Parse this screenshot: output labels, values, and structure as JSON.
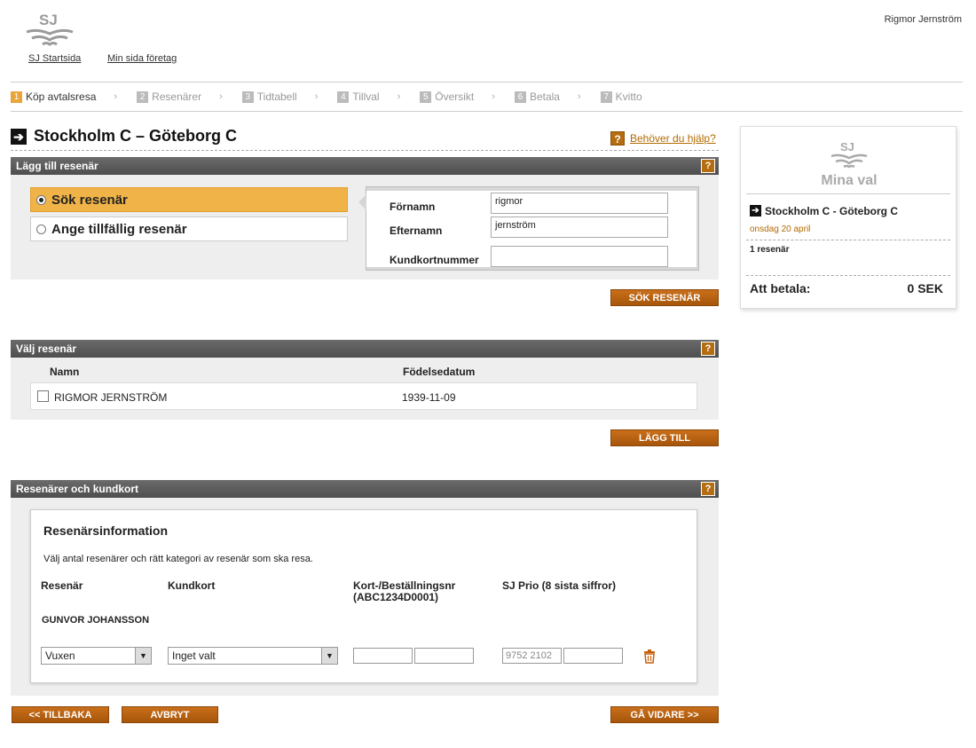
{
  "header": {
    "brand": "SJ",
    "links": [
      "SJ Startsida",
      "Min sida företag"
    ],
    "username": "Rigmor Jernström"
  },
  "steps": [
    {
      "num": "1",
      "label": "Köp avtalsresa"
    },
    {
      "num": "2",
      "label": "Resenärer"
    },
    {
      "num": "3",
      "label": "Tidtabell"
    },
    {
      "num": "4",
      "label": "Tillval"
    },
    {
      "num": "5",
      "label": "Översikt"
    },
    {
      "num": "6",
      "label": "Betala"
    },
    {
      "num": "7",
      "label": "Kvitto"
    }
  ],
  "page": {
    "title": "Stockholm C – Göteborg C",
    "help": "Behöver du hjälp?"
  },
  "add_traveler": {
    "heading": "Lägg till resenär",
    "option_search": "Sök resenär",
    "option_temp": "Ange tillfällig resenär",
    "firstname_label": "Förnamn",
    "firstname_value": "rigmor",
    "lastname_label": "Efternamn",
    "lastname_value": "jernström",
    "cardnum_label": "Kundkortnummer",
    "cardnum_value": "",
    "search_button": "SÖK RESENÄR"
  },
  "choose_traveler": {
    "heading": "Välj resenär",
    "col_name": "Namn",
    "col_birth": "Födelsedatum",
    "rows": [
      {
        "name": "RIGMOR JERNSTRÖM",
        "birth": "1939-11-09"
      }
    ],
    "add_button": "LÄGG TILL"
  },
  "travelers_cards": {
    "heading": "Resenärer och kundkort",
    "info_title": "Resenärsinformation",
    "info_text": "Välj antal resenärer och rätt kategori av resenär som ska resa.",
    "col_traveler": "Resenär",
    "col_card": "Kundkort",
    "col_booking": "Kort-/Beställningsnr",
    "col_booking_sub": "(ABC1234D0001)",
    "col_prio": "SJ Prio (8 sista siffror)",
    "traveler_name": "GUNVOR JOHANSSON",
    "category": "Vuxen",
    "card": "Inget valt",
    "booking_1": "",
    "booking_2": "",
    "prio_1": "9752 2102",
    "prio_2": ""
  },
  "footer": {
    "back": "<< TILLBAKA",
    "cancel": "AVBRYT",
    "next": "GÅ VIDARE >>"
  },
  "panel": {
    "brand": "SJ",
    "title": "Mina val",
    "route": "Stockholm C - Göteborg C",
    "date": "onsdag 20 april",
    "travelers": "1 resenär",
    "pay_label": "Att betala:",
    "pay_value": "0 SEK"
  },
  "colors": {
    "accent": "#e9a43a",
    "button": "#b2600f",
    "header_bar": "#5a5a5a"
  }
}
